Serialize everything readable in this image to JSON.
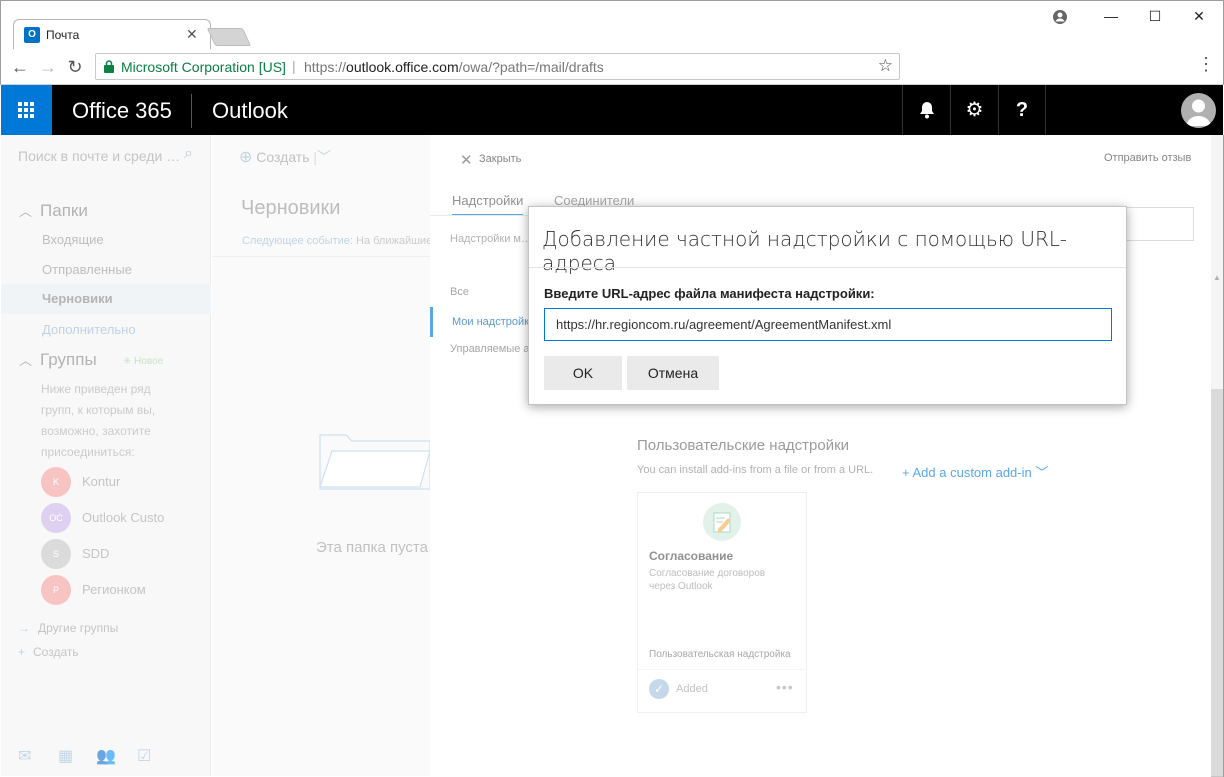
{
  "browser": {
    "tab_title": "Почта",
    "tab_favicon": "O",
    "tab_close": "✕",
    "window_controls": {
      "minimize": "—",
      "maximize": "☐",
      "close": "✕"
    },
    "secure_label": "Microsoft Corporation [US]",
    "url_scheme": "https://",
    "url_host": "outlook.office.com",
    "url_path": "/owa/?path=/mail/drafts"
  },
  "header": {
    "brand": "Office 365",
    "app_name": "Outlook"
  },
  "left_pane": {
    "search_placeholder": "Поиск в почте и среди …",
    "folders_header": "Папки",
    "folders": [
      {
        "label": "Входящие"
      },
      {
        "label": "Отправленные"
      },
      {
        "label": "Черновики"
      },
      {
        "label": "Дополнительно"
      }
    ],
    "groups_header": "Группы",
    "new_badge": "Новое",
    "groups_desc": "Ниже приведен ряд групп, к которым вы, возможно, захотите присоединиться:",
    "groups": [
      {
        "initials": "K",
        "name": "Kontur",
        "color": "#f4a3a3"
      },
      {
        "initials": "OC",
        "name": "Outlook Custo",
        "color": "#cdb7ea"
      },
      {
        "initials": "S",
        "name": "SDD",
        "color": "#c8c8c8"
      },
      {
        "initials": "P",
        "name": "Регионком",
        "color": "#f4a3a3"
      }
    ],
    "other_groups": "Другие группы",
    "create_group": "Создать"
  },
  "mid_pane": {
    "new_label": "Создать",
    "title": "Черновики",
    "next_event_label": "Следующее событие:",
    "next_event_text": "На ближайшие",
    "empty_text": "Эта папка пуста"
  },
  "addins": {
    "close_label": "Закрыть",
    "feedback": "Отправить отзыв",
    "tabs": [
      "Надстройки",
      "Соединители"
    ],
    "intro": "Надстройки м… принимаете у…",
    "nav_all": "Все",
    "nav_mine": "Мои надстройки",
    "nav_managed": "Управляемые администратором",
    "custom_header": "Пользовательские надстройки",
    "custom_sub": "You can install add-ins from a file or from a URL.",
    "add_custom": "Add a custom add-in",
    "card": {
      "title": "Согласование",
      "desc": "Согласование договоров через Outlook",
      "type": "Пользовательская надстройка",
      "status": "Added"
    }
  },
  "dialog": {
    "title": "Добавление частной надстройки с помощью URL-адреса",
    "label": "Введите URL-адрес файла манифеста надстройки:",
    "input_value": "https://hr.regioncom.ru/agreement/AgreementManifest.xml",
    "ok_label": "OK",
    "cancel_label": "Отмена"
  },
  "colors": {
    "accent": "#0078d7",
    "header_bg": "#000000"
  },
  "icons": [
    "back-icon",
    "forward-icon",
    "reload-icon",
    "lock-icon",
    "star-icon",
    "menu-icon",
    "waffle-icon",
    "bell-icon",
    "gear-icon",
    "help-icon",
    "search-icon",
    "close-icon",
    "mail-icon",
    "calendar-icon",
    "people-icon",
    "tasks-icon"
  ]
}
